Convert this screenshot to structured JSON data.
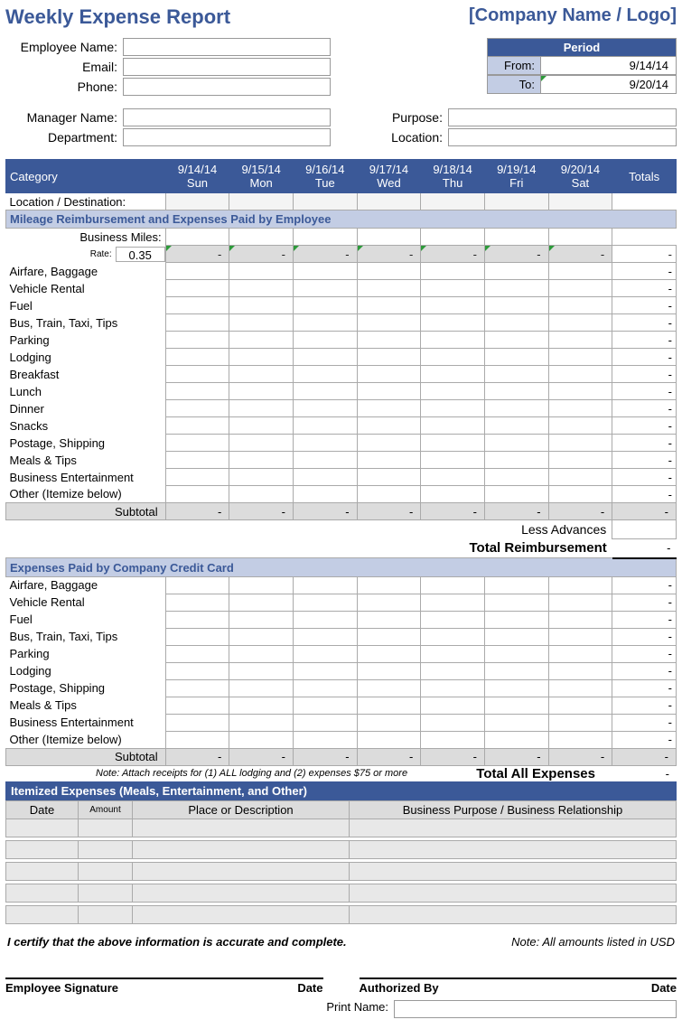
{
  "header": {
    "title": "Weekly Expense Report",
    "company": "[Company Name / Logo]"
  },
  "info": {
    "employee_name_label": "Employee Name:",
    "email_label": "Email:",
    "phone_label": "Phone:",
    "manager_label": "Manager Name:",
    "dept_label": "Department:",
    "purpose_label": "Purpose:",
    "location_label": "Location:"
  },
  "period": {
    "hdr": "Period",
    "from_lbl": "From:",
    "from_val": "9/14/14",
    "to_lbl": "To:",
    "to_val": "9/20/14"
  },
  "cols": {
    "category": "Category",
    "days": [
      {
        "date": "9/14/14",
        "dow": "Sun"
      },
      {
        "date": "9/15/14",
        "dow": "Mon"
      },
      {
        "date": "9/16/14",
        "dow": "Tue"
      },
      {
        "date": "9/17/14",
        "dow": "Wed"
      },
      {
        "date": "9/18/14",
        "dow": "Thu"
      },
      {
        "date": "9/19/14",
        "dow": "Fri"
      },
      {
        "date": "9/20/14",
        "dow": "Sat"
      }
    ],
    "totals": "Totals"
  },
  "loc_dest": "Location / Destination:",
  "sect1": {
    "title": "Mileage Reimbursement and Expenses Paid by Employee",
    "biz_miles": "Business Miles:",
    "rate_lbl": "Rate:",
    "rate_val": "0.35",
    "dash": "-",
    "rows": [
      "Airfare, Baggage",
      "Vehicle Rental",
      "Fuel",
      "Bus, Train, Taxi, Tips",
      "Parking",
      "Lodging",
      "Breakfast",
      "Lunch",
      "Dinner",
      "Snacks",
      "Postage, Shipping",
      "Meals & Tips",
      "Business Entertainment",
      "Other (Itemize below)"
    ],
    "subtotal": "Subtotal",
    "less_adv": "Less Advances",
    "total_reimb": "Total Reimbursement"
  },
  "sect2": {
    "title": "Expenses Paid by Company Credit Card",
    "rows": [
      "Airfare, Baggage",
      "Vehicle Rental",
      "Fuel",
      "Bus, Train, Taxi, Tips",
      "Parking",
      "Lodging",
      "Postage, Shipping",
      "Meals & Tips",
      "Business Entertainment",
      "Other (Itemize below)"
    ],
    "subtotal": "Subtotal",
    "note": "Note:  Attach receipts for (1) ALL lodging and (2) expenses $75 or more",
    "total_all": "Total All Expenses"
  },
  "itemized": {
    "title": "Itemized Expenses (Meals, Entertainment, and Other)",
    "hdr": {
      "date": "Date",
      "amount": "Amount",
      "place": "Place or Description",
      "purpose": "Business Purpose / Business Relationship"
    }
  },
  "footer": {
    "certify": "I certify that the above information is accurate and complete.",
    "usd_note": "Note: All amounts listed in USD",
    "emp_sig": "Employee Signature",
    "date": "Date",
    "auth_by": "Authorized By",
    "print_name": "Print Name:"
  }
}
